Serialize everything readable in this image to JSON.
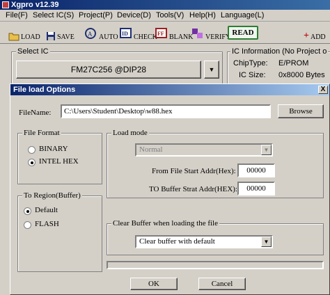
{
  "app": {
    "title": "Xgpro v12.39"
  },
  "menu": [
    "File(F)",
    "Select IC(S)",
    "Project(P)",
    "Device(D)",
    "Tools(V)",
    "Help(H)",
    "Language(L)"
  ],
  "toolbar": {
    "load": "LOAD",
    "save": "SAVE",
    "auto": "AUTO",
    "check": "CHECK",
    "blank": "BLANK",
    "verify": "VERIFY",
    "read": "READ",
    "add": "ADD"
  },
  "select_ic": {
    "label": "Select IC",
    "value": "FM27C256 @DIP28"
  },
  "ic_info": {
    "label": "IC Information (No Project o",
    "chip_type_label": "ChipType:",
    "chip_type_value": "E/PROM",
    "ic_size_label": "IC Size:",
    "ic_size_value": "0x8000 Bytes"
  },
  "dialog": {
    "title": "File load Options",
    "close": "X",
    "filename_label": "FileName:",
    "filename_value": "C:\\Users\\Student\\Desktop\\w88.hex",
    "browse": "Browse",
    "file_format": {
      "label": "File Format",
      "binary": "BINARY",
      "intel_hex": "INTEL HEX",
      "selected": "INTEL HEX"
    },
    "load_mode": {
      "label": "Load mode",
      "mode_value": "Normal",
      "start_label": "From File Start Addr(Hex):",
      "start_value": "00000",
      "buffer_label": "TO Buffer Strat Addr(HEX):",
      "buffer_value": "00000"
    },
    "to_region": {
      "label": "To Region(Buffer)",
      "default": "Default",
      "flash": "FLASH",
      "selected": "Default"
    },
    "clear_buffer": {
      "label": "Clear Buffer when loading the file",
      "value": "Clear buffer with default"
    },
    "ok": "OK",
    "cancel": "Cancel"
  }
}
